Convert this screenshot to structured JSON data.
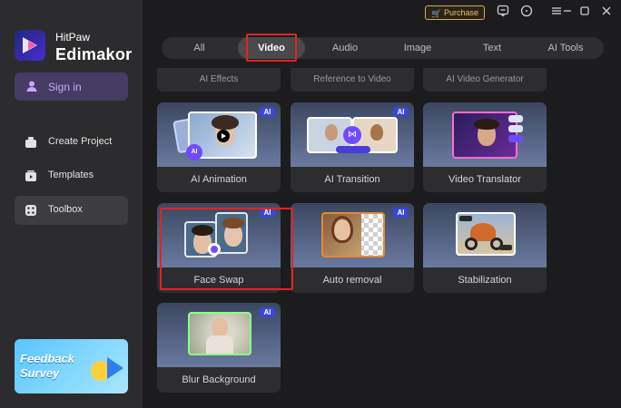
{
  "app": {
    "brand_top": "HitPaw",
    "brand_bottom": "Edimakor",
    "logo_icon": "edimakor-logo-icon"
  },
  "sidebar": {
    "signin_label": "Sign in",
    "items": [
      {
        "label": "Create Project",
        "icon": "create-project-icon"
      },
      {
        "label": "Templates",
        "icon": "templates-icon"
      },
      {
        "label": "Toolbox",
        "icon": "toolbox-icon",
        "active": true
      }
    ],
    "feedback_line1": "Feedback",
    "feedback_line2": "Survey"
  },
  "titlebar": {
    "purchase_label": "Purchase",
    "icons": [
      "message-icon",
      "help-icon",
      "menu-icon",
      "minimize-icon",
      "maximize-icon",
      "close-icon"
    ]
  },
  "tabs": [
    {
      "label": "All"
    },
    {
      "label": "Video",
      "active": true
    },
    {
      "label": "Audio"
    },
    {
      "label": "Image"
    },
    {
      "label": "Text"
    },
    {
      "label": "AI Tools"
    }
  ],
  "partial_cards": [
    "AI Effects",
    "Reference to Video",
    "AI Video Generator"
  ],
  "cards": [
    {
      "label": "AI Animation",
      "badge": "AI"
    },
    {
      "label": "AI Transition",
      "badge": "AI"
    },
    {
      "label": "Video Translator"
    },
    {
      "label": "Face Swap",
      "badge": "AI"
    },
    {
      "label": "Auto removal",
      "badge": "AI"
    },
    {
      "label": "Stabilization"
    },
    {
      "label": "Blur Background",
      "badge": "AI"
    }
  ],
  "colors": {
    "accent_purple": "#c6a6ff",
    "ai_badge": "#3b47d6",
    "highlight_red": "#e02424",
    "purchase_gold": "#d8a85a"
  }
}
